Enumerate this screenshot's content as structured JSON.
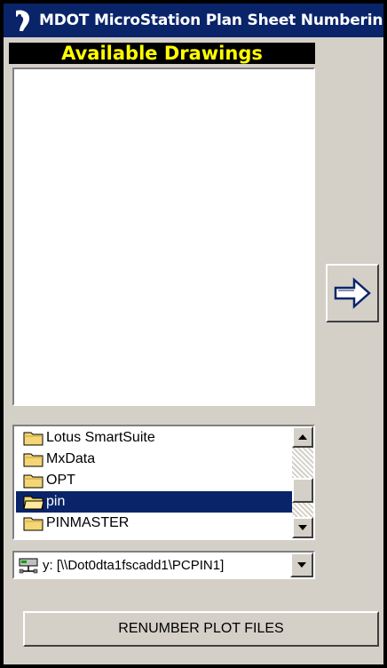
{
  "window": {
    "title": "MDOT MicroStation Plan Sheet Numbering",
    "icon": "app-icon"
  },
  "drawings_panel": {
    "header": "Available Drawings",
    "items": []
  },
  "move_button": {
    "icon": "right-arrow-icon"
  },
  "folder_list": {
    "items": [
      {
        "label": "Lotus SmartSuite",
        "selected": false
      },
      {
        "label": "MxData",
        "selected": false
      },
      {
        "label": "OPT",
        "selected": false
      },
      {
        "label": "pin",
        "selected": true
      },
      {
        "label": "PINMASTER",
        "selected": false
      }
    ]
  },
  "drive_select": {
    "value": "y: [\\\\Dot0dta1fscadd1\\PCPIN1]",
    "icon": "network-drive-icon"
  },
  "renumber_button": {
    "label": "RENUMBER PLOT FILES"
  },
  "colors": {
    "titlebar": "#0a246a",
    "header_bg": "#000000",
    "header_text": "#ffff00",
    "selection": "#0a246a",
    "dialog_bg": "#d4d0c8"
  }
}
